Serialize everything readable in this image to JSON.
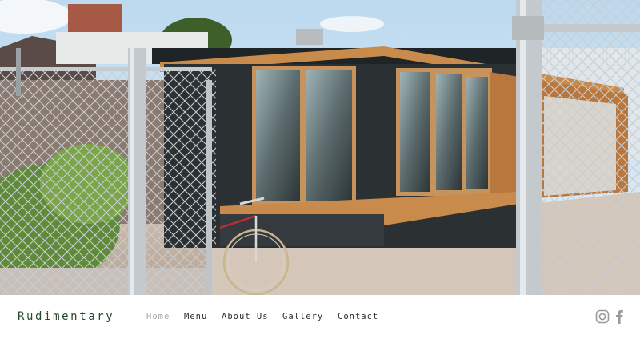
{
  "brand": {
    "name": "Rudimentary"
  },
  "nav": {
    "items": [
      {
        "label": "Home",
        "active": true
      },
      {
        "label": "Menu",
        "active": false
      },
      {
        "label": "About Us",
        "active": false
      },
      {
        "label": "Gallery",
        "active": false
      },
      {
        "label": "Contact",
        "active": false
      }
    ]
  },
  "social": [
    {
      "icon": "instagram-icon"
    },
    {
      "icon": "facebook-icon"
    }
  ],
  "colors": {
    "brand_text": "#234a2c",
    "nav_text": "#2b2b2b",
    "nav_active": "#a9a9a9",
    "social_icon": "#9a9a9a"
  }
}
